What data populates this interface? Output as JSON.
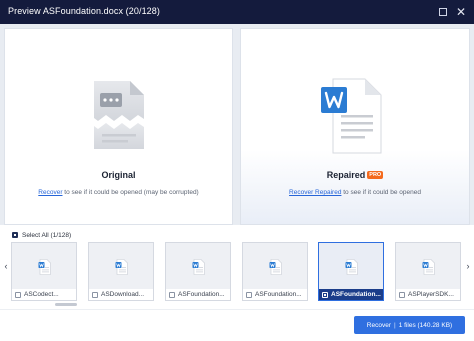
{
  "window": {
    "title": "Preview ASFoundation.docx (20/128)",
    "maximize_icon": "square-outline",
    "close_icon": "x-mark"
  },
  "original": {
    "title": "Original",
    "link": "Recover",
    "subtitle": " to see if it could be opened (may be corrupted)",
    "icon": "broken-document-icon"
  },
  "repaired": {
    "title": "Repaired",
    "badge": "PRO",
    "link": "Recover Repaired",
    "subtitle": " to see if it could be opened",
    "icon": "word-document-icon"
  },
  "select_all": {
    "label": "Select All (1/128)",
    "checked": true
  },
  "files": [
    {
      "name": "ASCodect...",
      "checked": false,
      "selected": false
    },
    {
      "name": "ASDownload...",
      "checked": false,
      "selected": false
    },
    {
      "name": "ASFoundation...",
      "checked": false,
      "selected": false
    },
    {
      "name": "ASFoundation...",
      "checked": false,
      "selected": false
    },
    {
      "name": "ASFoundation...",
      "checked": true,
      "selected": true
    },
    {
      "name": "ASPlayerSDK...",
      "checked": false,
      "selected": false
    }
  ],
  "nav": {
    "prev_icon": "chevron-left-icon",
    "next_icon": "chevron-right-icon"
  },
  "recover_button": {
    "label": "Recover",
    "count": "1 files (140.28 KB)"
  },
  "colors": {
    "titlebar": "#141b3d",
    "accent": "#2f6fe0",
    "pro_badge": "#f46a1d",
    "word_blue": "#2b7cd3"
  }
}
